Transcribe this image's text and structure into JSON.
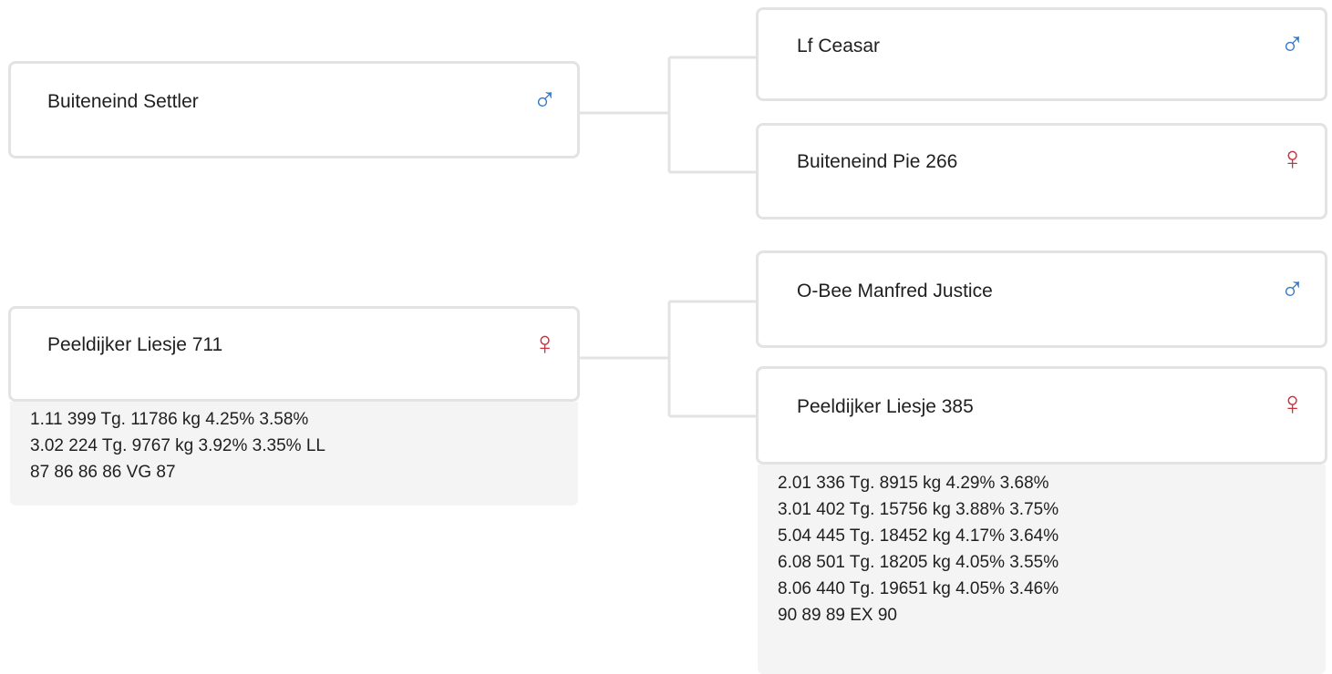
{
  "parents": [
    {
      "name": "Buiteneind Settler",
      "sex_symbol": "♂",
      "sex": "male",
      "info": [],
      "parents": [
        {
          "name": "Lf Ceasar",
          "sex_symbol": "♂",
          "sex": "male",
          "info": []
        },
        {
          "name": "Buiteneind Pie 266",
          "sex_symbol": "♀",
          "sex": "female",
          "info": []
        }
      ]
    },
    {
      "name": "Peeldijker Liesje 711",
      "sex_symbol": "♀",
      "sex": "female",
      "info": [
        "1.11 399 Tg. 11786 kg 4.25% 3.58%",
        "3.02 224 Tg. 9767 kg 3.92% 3.35% LL",
        "87 86 86 86 VG 87"
      ],
      "parents": [
        {
          "name": "O-Bee Manfred Justice",
          "sex_symbol": "♂",
          "sex": "male",
          "info": []
        },
        {
          "name": "Peeldijker Liesje 385",
          "sex_symbol": "♀",
          "sex": "female",
          "info": [
            "2.01 336 Tg. 8915 kg 4.29% 3.68%",
            "3.01 402 Tg. 15756 kg 3.88% 3.75%",
            "5.04 445 Tg. 18452 kg 4.17% 3.64%",
            "6.08 501 Tg. 18205 kg 4.05% 3.55%",
            "8.06 440 Tg. 19651 kg 4.05% 3.46%",
            "90 89 89 EX 90"
          ]
        }
      ]
    }
  ],
  "colors": {
    "male": "#2f76c4",
    "female": "#d12f3a",
    "border": "#e3e3e3",
    "info_bg": "#f4f4f4"
  }
}
